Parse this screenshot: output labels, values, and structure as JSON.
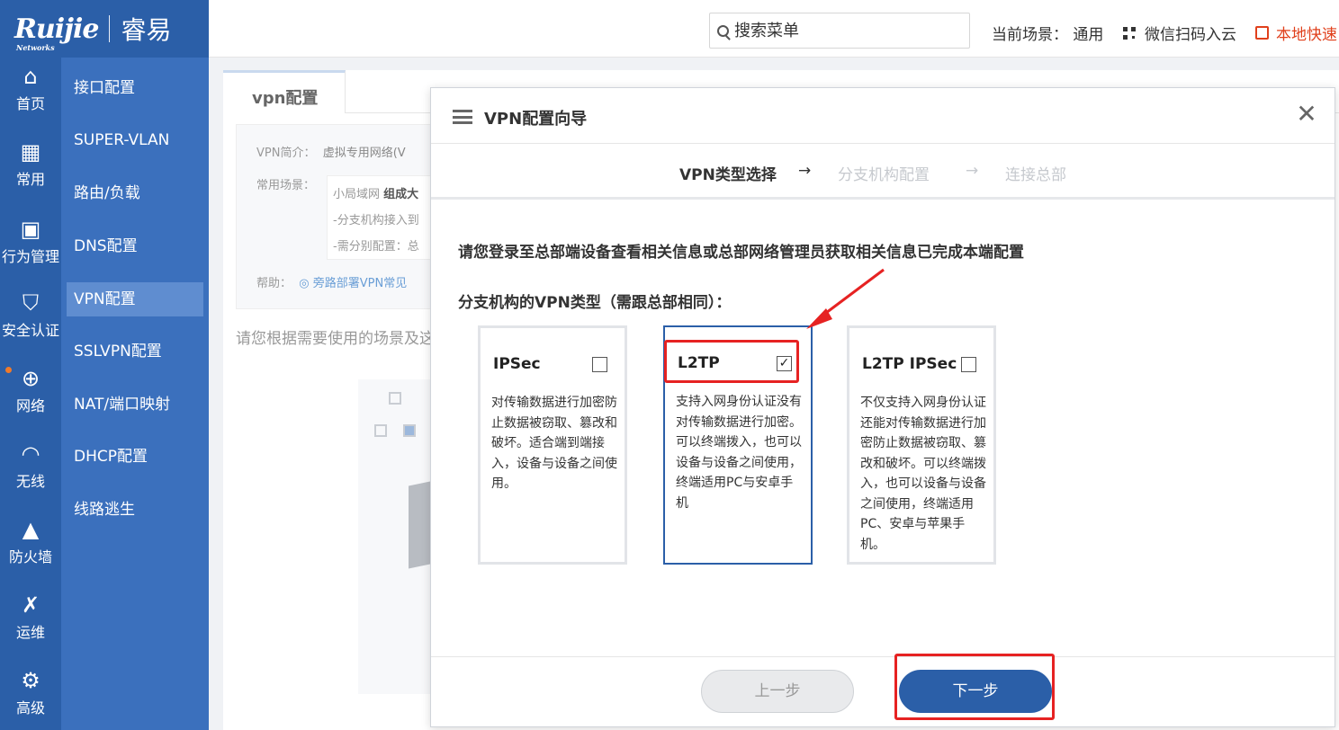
{
  "header": {
    "brand": "Ruijie",
    "brand_sub": "Networks",
    "brand_cn": "睿易",
    "search_placeholder": "搜索菜单",
    "scene_label": "当前场景：",
    "scene_value": "通用",
    "qr_label": "微信扫码入云",
    "quick_label": "本地快速"
  },
  "nav_primary": [
    {
      "label": "首页",
      "icon": "home-icon",
      "glyph": "⌂"
    },
    {
      "label": "常用",
      "icon": "apps-icon",
      "glyph": "▦"
    },
    {
      "label": "行为管理",
      "icon": "monitor-icon",
      "glyph": "▣"
    },
    {
      "label": "安全认证",
      "icon": "shield-icon",
      "glyph": "⛉"
    },
    {
      "label": "网络",
      "icon": "globe-icon",
      "glyph": "⊕",
      "active": true
    },
    {
      "label": "无线",
      "icon": "wifi-icon",
      "glyph": "◠"
    },
    {
      "label": "防火墙",
      "icon": "firewall-icon",
      "glyph": "▲"
    },
    {
      "label": "运维",
      "icon": "tools-icon",
      "glyph": "✗"
    },
    {
      "label": "高级",
      "icon": "gear-icon",
      "glyph": "⚙"
    }
  ],
  "nav_secondary": [
    {
      "label": "接口配置"
    },
    {
      "label": "SUPER-VLAN"
    },
    {
      "label": "路由/负载"
    },
    {
      "label": "DNS配置"
    },
    {
      "label": "VPN配置",
      "active": true
    },
    {
      "label": "SSLVPN配置"
    },
    {
      "label": "NAT/端口映射"
    },
    {
      "label": "DHCP配置"
    },
    {
      "label": "线路逃生"
    }
  ],
  "page": {
    "tab": "vpn配置",
    "intro_label": "VPN简介：",
    "intro_value": "虚拟专用网络(V",
    "scene_label": "常用场景：",
    "scene_line1_pre": "小局域网 ",
    "scene_line1_bold": "组成大",
    "scene_line2": "-分支机构接入到",
    "scene_line3": "-需分别配置：总",
    "help_label": "帮助：",
    "help_link": "旁路部署VPN常见",
    "hint": "请您根据需要使用的场景及这"
  },
  "dialog": {
    "title": "VPN配置向导",
    "steps": [
      "VPN类型选择",
      "分支机构配置",
      "连接总部"
    ],
    "step_arrow": "→",
    "notice": "请您登录至总部端设备查看相关信息或总部网络管理员获取相关信息已完成本端配置",
    "subtitle": "分支机构的VPN类型（需跟总部相同）：",
    "cards": [
      {
        "name": "IPSec",
        "checked": false,
        "mark": "",
        "desc": "对传输数据进行加密防止数据被窃取、篡改和破坏。适合端到端接入，设备与设备之间使用。"
      },
      {
        "name": "L2TP",
        "checked": true,
        "mark": "✓",
        "desc": "支持入网身份认证没有对传输数据进行加密。可以终端拨入，也可以设备与设备之间使用，终端适用PC与安卓手机"
      },
      {
        "name": "L2TP IPSec",
        "checked": false,
        "mark": "",
        "desc": "不仅支持入网身份认证还能对传输数据进行加密防止数据被窃取、篡改和破坏。可以终端拨入，也可以设备与设备之间使用，终端适用PC、安卓与苹果手机。"
      }
    ],
    "prev_label": "上一步",
    "next_label": "下一步",
    "close_glyph": "✕"
  },
  "colors": {
    "brand_blue": "#2b5fa8",
    "nav2_blue": "#3b70bd",
    "highlight_red": "#e62222",
    "quick_orange": "#e0401c"
  }
}
